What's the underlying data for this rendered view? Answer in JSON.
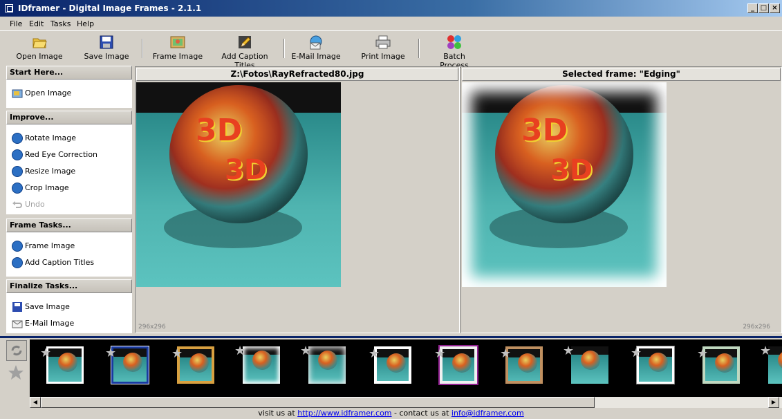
{
  "window": {
    "title": "IDframer - Digital Image Frames - 2.1.1"
  },
  "menu": [
    "File",
    "Edit",
    "Tasks",
    "Help"
  ],
  "toolbar": {
    "open": "Open Image",
    "save": "Save Image",
    "frame": "Frame Image",
    "caption": "Add Caption Titles",
    "email": "E-Mail Image",
    "print": "Print Image",
    "batch": "Batch Process"
  },
  "tasks": {
    "start": {
      "header": "Start Here...",
      "items": [
        "Open Image"
      ]
    },
    "improve": {
      "header": "Improve...",
      "items": [
        "Rotate Image",
        "Red Eye Correction",
        "Resize Image",
        "Crop Image",
        "Undo"
      ]
    },
    "frame": {
      "header": "Frame Tasks...",
      "items": [
        "Frame Image",
        "Add Caption Titles"
      ]
    },
    "finalize": {
      "header": "Finalize Tasks...",
      "items": [
        "Save Image",
        "E-Mail Image"
      ]
    }
  },
  "left_pane": {
    "title": "Z:\\Fotos\\RayRefracted80.jpg",
    "dims": "296x296"
  },
  "right_pane": {
    "title": "Selected frame: \"Edging\"",
    "dims": "296x296"
  },
  "status": {
    "prefix": "visit us at",
    "url": "http://www.idframer.com",
    "middle": "- contact us at",
    "email": "info@idframer.com"
  },
  "colors": {
    "title_bar": "#0a246a",
    "film_bg": "#000000",
    "link": "#0000ee"
  }
}
